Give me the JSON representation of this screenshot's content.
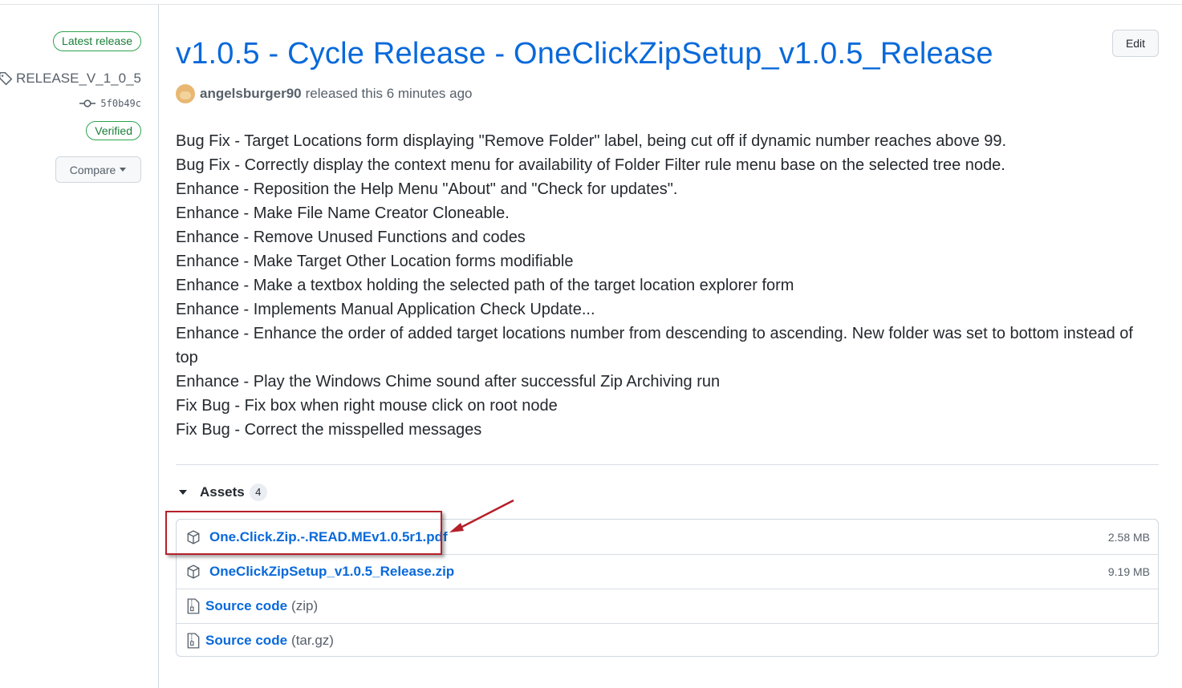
{
  "sidebar": {
    "latest_badge": "Latest release",
    "tag": "RELEASE_V_1_0_5",
    "commit": "5f0b49c",
    "verified": "Verified",
    "compare": "Compare"
  },
  "release": {
    "title": "v1.0.5 - Cycle Release - OneClickZipSetup_v1.0.5_Release",
    "edit_label": "Edit",
    "author": "angelsburger90",
    "released_text": "released this 6 minutes ago",
    "notes": [
      "Bug Fix - Target Locations form displaying \"Remove Folder\" label, being cut off if dynamic number reaches above 99.",
      "Bug Fix - Correctly display the context menu for availability of Folder Filter rule menu base on the selected tree node.",
      "Enhance - Reposition the Help Menu \"About\" and \"Check for updates\".",
      "Enhance - Make File Name Creator Cloneable.",
      "Enhance - Remove Unused Functions and codes",
      "Enhance - Make Target Other Location forms modifiable",
      "Enhance - Make a textbox holding the selected path of the target location explorer form",
      "Enhance - Implements Manual Application Check Update...",
      "Enhance - Enhance the order of added target locations number from descending to ascending. New folder was set to bottom instead of top",
      "Enhance - Play the Windows Chime sound after successful Zip Archiving run",
      "Fix Bug - Fix box when right mouse click on root node",
      "Fix Bug - Correct the misspelled messages"
    ]
  },
  "assets": {
    "label": "Assets",
    "count": "4",
    "items": [
      {
        "name": "One.Click.Zip.-.READ.MEv1.0.5r1.pdf",
        "size": "2.58 MB",
        "icon": "package-icon"
      },
      {
        "name": "OneClickZipSetup_v1.0.5_Release.zip",
        "size": "9.19 MB",
        "icon": "package-icon"
      }
    ],
    "sources": [
      {
        "label": "Source code",
        "ext": "(zip)",
        "icon": "file-zip-icon"
      },
      {
        "label": "Source code",
        "ext": "(tar.gz)",
        "icon": "file-zip-icon"
      }
    ]
  },
  "annotation": {
    "highlight_color": "#b5202a"
  }
}
